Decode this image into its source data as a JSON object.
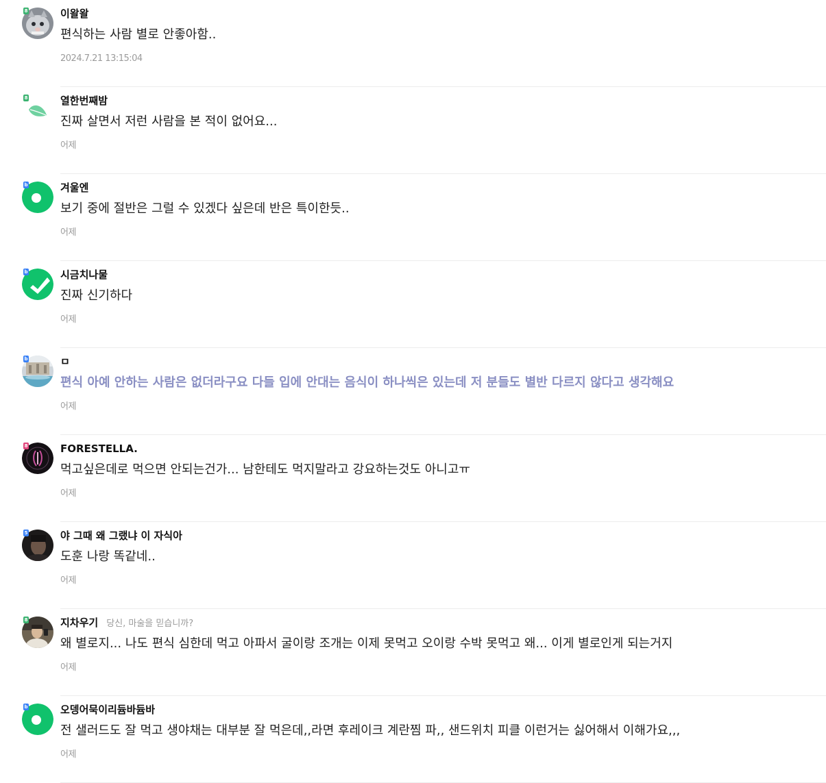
{
  "comments": [
    {
      "nickname": "이왈왈",
      "status": "",
      "content": "편식하는 사람 별로 안좋아함..",
      "date": "2024.7.21 13:15:04",
      "badge": "8",
      "badge_color": "#3cb371",
      "avatar": "cat-avatar"
    },
    {
      "nickname": "열한번째밤",
      "status": "",
      "content": "진짜 살면서 저런 사람을 본 적이 없어요...",
      "date": "어제",
      "badge": "8",
      "badge_color": "#3cb371",
      "avatar": "leaf-avatar"
    },
    {
      "nickname": "겨울엔",
      "status": "",
      "content": "보기 중에 절반은 그럴 수 있겠다 싶은데 반은 특이한듯..",
      "date": "어제",
      "badge": "b",
      "badge_color": "#3b82f6",
      "avatar": "green-ring-avatar"
    },
    {
      "nickname": "시금치나물",
      "status": "",
      "content": "진짜 신기하다",
      "date": "어제",
      "badge": "b",
      "badge_color": "#3b82f6",
      "avatar": "green-check-avatar"
    },
    {
      "nickname": "ㅁ",
      "status": "",
      "content": "편식 아예 안하는 사람은 없더라구요 다들 입에 안대는 음식이 하나씩은 있는데 저 분들도 별반 다르지 않다고 생각해요",
      "date": "어제",
      "badge": "b",
      "badge_color": "#3b82f6",
      "avatar": "fountain-photo-avatar",
      "highlight": true
    },
    {
      "nickname": "FORESTELLA.",
      "status": "",
      "content": "먹고싶은데로 먹으면 안되는건가... 남한테도 먹지말라고 강요하는것도 아니고ㅠ",
      "date": "어제",
      "badge": "8",
      "badge_color": "#e0457b",
      "avatar": "forestella-logo-avatar"
    },
    {
      "nickname": "야 그때 왜 그랬냐 이 자식아",
      "status": "",
      "content": "도훈 나랑 똑같네..",
      "date": "어제",
      "badge": "5",
      "badge_color": "#3b82f6",
      "avatar": "person-photo-avatar"
    },
    {
      "nickname": "지차우기",
      "status": "당신, 마술을 믿습니까?",
      "content": "왜 별로지... 나도 편식 심한데 먹고 아파서 굴이랑 조개는 이제 못먹고 오이랑 수박 못먹고 왜... 이게 별로인게 되는거지",
      "date": "어제",
      "badge": "8",
      "badge_color": "#3cb371",
      "avatar": "selfie-photo-avatar"
    },
    {
      "nickname": "오뎅어묵이리듐바듐바",
      "status": "",
      "content": "전 샐러드도 잘 먹고 생야채는 대부분 잘 먹은데,,라면 후레이크 계란찜 파,, 샌드위치 피클 이런거는 싫어해서 이해가요,,,",
      "date": "어제",
      "badge": "b",
      "badge_color": "#3b82f6",
      "avatar": "green-ring-avatar"
    }
  ]
}
